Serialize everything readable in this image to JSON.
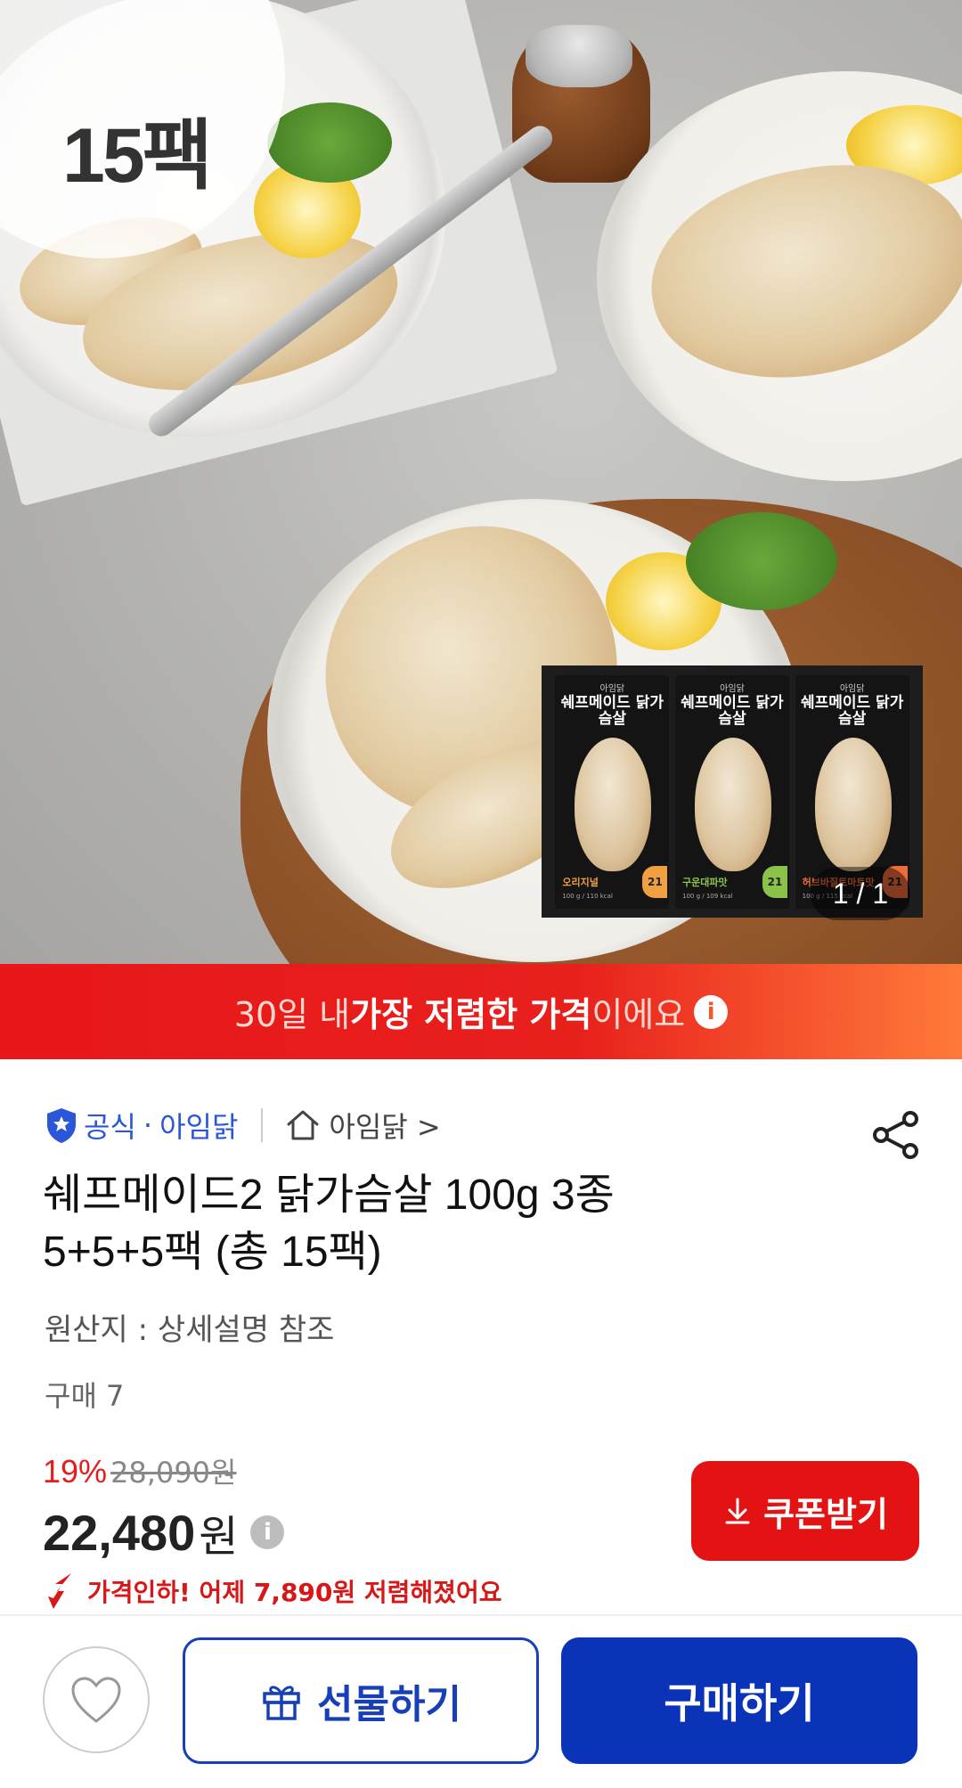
{
  "hero": {
    "badge_text": "15팩",
    "image_counter": "1 / 1",
    "package": {
      "brand": "아임닭",
      "product": "쉐프메이드 닭가슴살",
      "flavors": [
        {
          "name": "오리지널",
          "nutrition": "100 g / 110 kcal",
          "tag": "21",
          "color": "#f0a040"
        },
        {
          "name": "구운대파맛",
          "nutrition": "100 g / 109 kcal",
          "tag": "21",
          "color": "#8bc34a"
        },
        {
          "name": "허브바질토마토맛",
          "nutrition": "100 g / 115 kcal",
          "tag": "21",
          "color": "#f06a3a"
        }
      ]
    }
  },
  "banner": {
    "pre": "30일 내 ",
    "bold": "가장 저렴한 가격",
    "post": "이에요",
    "info_icon": "info-icon"
  },
  "seller": {
    "official_label": "공식",
    "dot": "·",
    "brand": "아임닭",
    "store_label": "아임닭 >",
    "icons": [
      "shield-check-icon",
      "home-icon",
      "share-icon"
    ]
  },
  "product": {
    "title_line1": "쉐프메이드2 닭가슴살 100g 3종",
    "title_line2": "5+5+5팩 (총 15팩)",
    "origin": "원산지 : 상세설명 참조",
    "sold": "구매 7"
  },
  "price": {
    "discount": "19%",
    "original": "28,090원",
    "current": "22,480",
    "currency": "원",
    "info_icon": "info-icon",
    "drop_text": "가격인하! 어제 7,890원 저렴해졌어요"
  },
  "coupon": {
    "label": "쿠폰받기",
    "icon": "download-icon"
  },
  "bottom": {
    "wish_icon": "heart-icon",
    "gift_label": "선물하기",
    "gift_icon": "gift-icon",
    "buy_label": "구매하기"
  },
  "colors": {
    "brand_blue": "#0a33b8",
    "accent_red": "#e41313",
    "link_blue": "#2a56d8"
  }
}
